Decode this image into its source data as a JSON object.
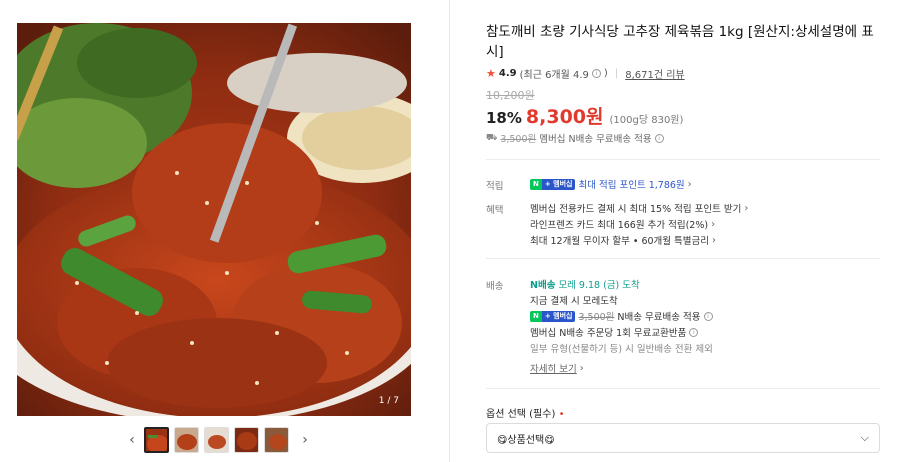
{
  "gallery": {
    "counter": "1 / 7",
    "thumb_count": 5,
    "prev_icon": "chevron-left-icon",
    "next_icon": "chevron-right-icon"
  },
  "product": {
    "title": "참도깨비 초량 기사식당 고추장 제육볶음 1kg [원산지:상세설명에 표시]",
    "rating": {
      "score": "4.9",
      "recent": "(최근 6개월 4.9",
      "recent_close": ")",
      "reviews": "8,671건 리뷰"
    },
    "original_price": "10,200원",
    "discount_rate": "18%",
    "sale_price": "8,300원",
    "unit_price": "(100g당 830원)",
    "shipping_line": {
      "strike": "3,500원",
      "text": "멤버십 N배송 무료배송 적용"
    }
  },
  "benefits": {
    "point_label": "적립",
    "npay_n": "N",
    "npay_m": "+ 멤버십",
    "point_text": "최대 적립 포인트 1,786원",
    "benefit_label": "혜택",
    "benefit_lines": [
      "멤버십 전용카드 결제 시 최대 15% 적립 포인트 받기",
      "라인프렌즈 카드 최대 166원 추가 적립(2%)",
      "최대 12개월 무이자 할부 • 60개월 특별금리"
    ]
  },
  "delivery": {
    "label": "배송",
    "badge": "N배송",
    "eta": "모레 9.18 (금) 도착",
    "pay_now": "지금 결제 시 모레도착",
    "free_strike": "3,500원",
    "free_text": "N배송 무료배송 적용",
    "return_text": "멤버십 N배송 주문당 1회 무료교환반품",
    "exclude_text": "일부 유형(선물하기 등) 시 일반배송 전환 제외",
    "details_link": "자세히 보기"
  },
  "options": {
    "label": "옵션 선택 (필수)",
    "required_mark": "•",
    "selected": "😋상품선택😋"
  },
  "colors": {
    "accent_red": "#e03a2c",
    "npay_green": "#03c75a",
    "membership_blue": "#2b56c9",
    "delivery_teal": "#0d9e8c"
  }
}
